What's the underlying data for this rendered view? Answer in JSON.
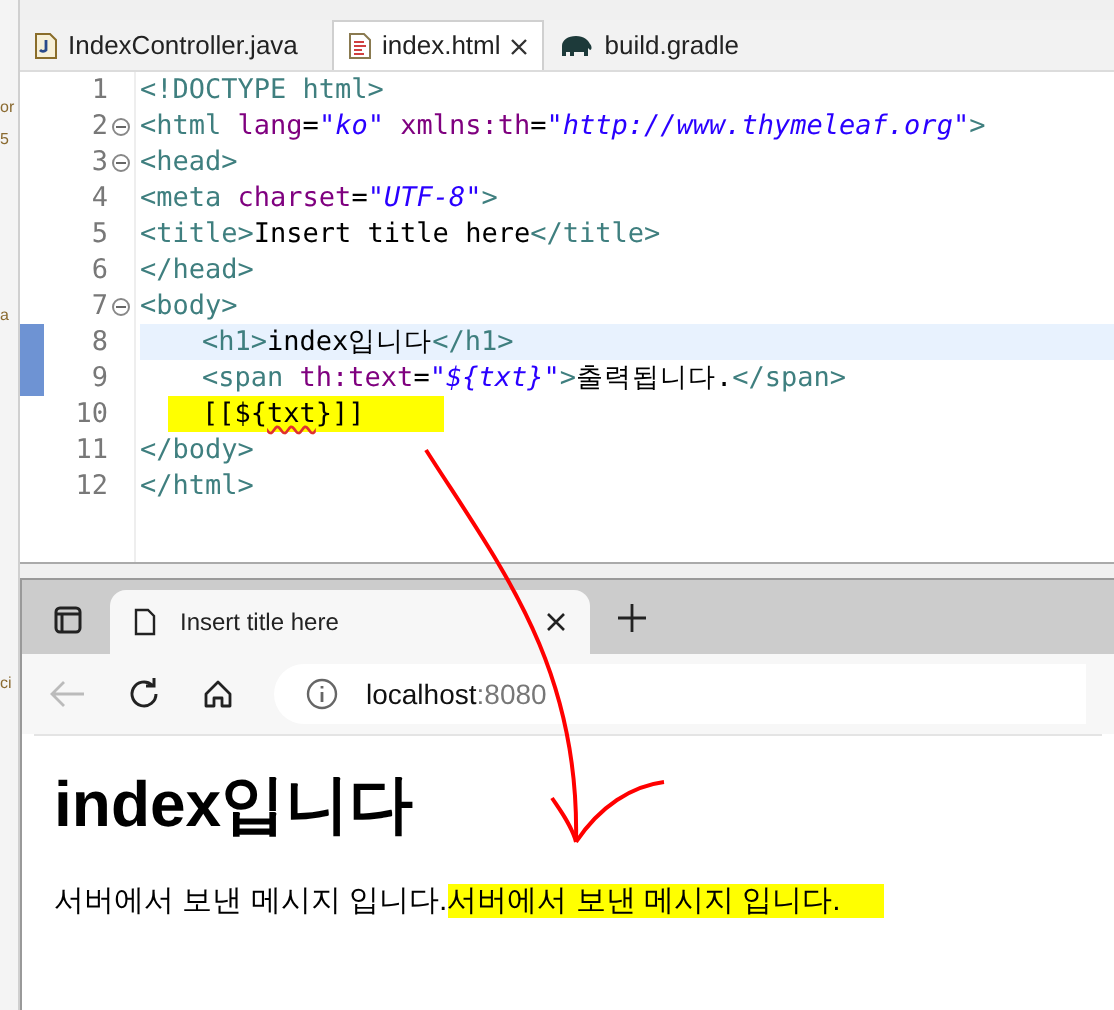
{
  "side_fragments": [
    {
      "text": "or"
    },
    {
      "text": "5"
    },
    {
      "text": "a"
    },
    {
      "text": "ci"
    }
  ],
  "editor": {
    "tabs": [
      {
        "label": "IndexController.java",
        "kind": "java",
        "selected": false,
        "closable": false
      },
      {
        "label": "index.html",
        "kind": "html",
        "selected": true,
        "closable": true
      },
      {
        "label": "build.gradle",
        "kind": "gradle",
        "selected": false,
        "closable": false
      }
    ],
    "lines": [
      {
        "number": "1",
        "fold": false,
        "current": false,
        "changed": false,
        "indent": false,
        "highlighted": false,
        "tokens": [
          {
            "kind": "tag",
            "text": "<!DOCTYPE html>"
          }
        ]
      },
      {
        "number": "2",
        "fold": true,
        "current": false,
        "changed": false,
        "indent": false,
        "highlighted": false,
        "tokens": [
          {
            "kind": "tag",
            "text": "<html "
          },
          {
            "kind": "attr",
            "text": "lang"
          },
          {
            "kind": "text",
            "text": "="
          },
          {
            "kind": "string",
            "text": "\"ko\""
          },
          {
            "kind": "attr",
            "text": " xmlns:th"
          },
          {
            "kind": "text",
            "text": "="
          },
          {
            "kind": "string",
            "text": "\"http://www.thymeleaf.org\""
          },
          {
            "kind": "tag",
            "text": ">"
          }
        ]
      },
      {
        "number": "3",
        "fold": true,
        "current": false,
        "changed": false,
        "indent": false,
        "highlighted": false,
        "tokens": [
          {
            "kind": "tag",
            "text": "<head>"
          }
        ]
      },
      {
        "number": "4",
        "fold": false,
        "current": false,
        "changed": false,
        "indent": false,
        "highlighted": false,
        "tokens": [
          {
            "kind": "tag",
            "text": "<meta "
          },
          {
            "kind": "attr",
            "text": "charset"
          },
          {
            "kind": "text",
            "text": "="
          },
          {
            "kind": "string",
            "text": "\"UTF-8\""
          },
          {
            "kind": "tag",
            "text": ">"
          }
        ]
      },
      {
        "number": "5",
        "fold": false,
        "current": false,
        "changed": false,
        "indent": false,
        "highlighted": false,
        "tokens": [
          {
            "kind": "tag",
            "text": "<title>"
          },
          {
            "kind": "text",
            "text": "Insert title here"
          },
          {
            "kind": "tag",
            "text": "</title>"
          }
        ]
      },
      {
        "number": "6",
        "fold": false,
        "current": false,
        "changed": false,
        "indent": false,
        "highlighted": false,
        "tokens": [
          {
            "kind": "tag",
            "text": "</head>"
          }
        ]
      },
      {
        "number": "7",
        "fold": true,
        "current": false,
        "changed": false,
        "indent": false,
        "highlighted": false,
        "tokens": [
          {
            "kind": "tag",
            "text": "<body>"
          }
        ]
      },
      {
        "number": "8",
        "fold": false,
        "current": true,
        "changed": true,
        "indent": true,
        "highlighted": false,
        "tokens": [
          {
            "kind": "tag",
            "text": "<h1>"
          },
          {
            "kind": "text",
            "text": "index입니다"
          },
          {
            "kind": "tag",
            "text": "</h1>"
          }
        ]
      },
      {
        "number": "9",
        "fold": false,
        "current": false,
        "changed": true,
        "indent": true,
        "highlighted": false,
        "tokens": [
          {
            "kind": "tag",
            "text": "<span "
          },
          {
            "kind": "attr",
            "text": "th:text"
          },
          {
            "kind": "text",
            "text": "="
          },
          {
            "kind": "string",
            "text": "\"${txt}\""
          },
          {
            "kind": "tag",
            "text": ">"
          },
          {
            "kind": "text",
            "text": "출력됩니다."
          },
          {
            "kind": "tag",
            "text": "</span>"
          }
        ]
      },
      {
        "number": "10",
        "fold": false,
        "current": false,
        "changed": false,
        "indent": true,
        "highlighted": true,
        "tokens": [
          {
            "kind": "text",
            "text": "[[${"
          },
          {
            "kind": "error",
            "text": "txt"
          },
          {
            "kind": "text",
            "text": "}]]"
          }
        ]
      },
      {
        "number": "11",
        "fold": false,
        "current": false,
        "changed": false,
        "indent": false,
        "highlighted": false,
        "tokens": [
          {
            "kind": "tag",
            "text": "</body>"
          }
        ]
      },
      {
        "number": "12",
        "fold": false,
        "current": false,
        "changed": false,
        "indent": false,
        "highlighted": false,
        "tokens": [
          {
            "kind": "tag",
            "text": "</html>"
          }
        ]
      }
    ]
  },
  "browser": {
    "tab": {
      "title": "Insert title here"
    },
    "address": {
      "host": "localhost",
      "port": ":8080"
    },
    "page": {
      "heading": "index입니다",
      "paragraph": "서버에서 보낸 메시지 입니다.",
      "highlighted_text": "서버에서 보낸 메시지 입니다."
    }
  }
}
